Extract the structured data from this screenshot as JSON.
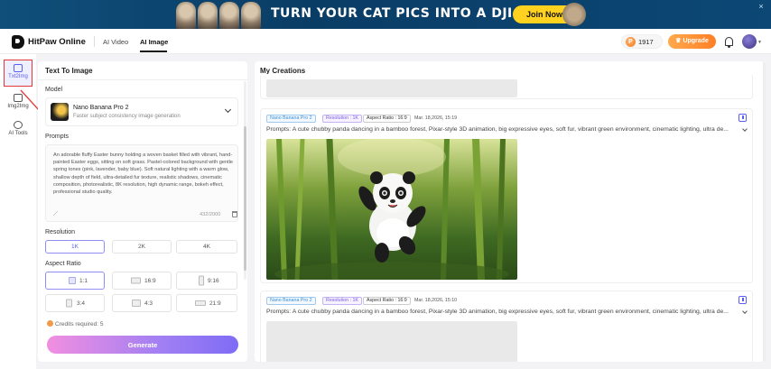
{
  "banner": {
    "headline": "TURN YOUR CAT PICS INTO A DJI",
    "cta": "Join Now",
    "close": "×"
  },
  "header": {
    "logo": "HitPaw Online",
    "nav": [
      {
        "label": "AI Video",
        "active": false
      },
      {
        "label": "AI Image",
        "active": true
      }
    ],
    "credits": "1917",
    "upgrade": "Upgrade"
  },
  "rail": [
    {
      "label": "Txt2Img",
      "active": true,
      "icon": "text-image-icon"
    },
    {
      "label": "Img2Img",
      "active": false,
      "icon": "image-image-icon"
    },
    {
      "label": "AI Tools",
      "active": false,
      "icon": "tools-icon"
    }
  ],
  "panel": {
    "title": "Text To Image",
    "model_label": "Model",
    "model_name": "Nano Banana Pro 2",
    "model_desc": "Faster subject consistency image generation",
    "prompts_label": "Prompts",
    "prompt_text": "An adorable fluffy Easter bunny holding a woven basket filled with vibrant, hand-painted Easter eggs, sitting on soft grass. Pastel-colored background with gentle spring tones (pink, lavender, baby blue). Soft natural lighting with a warm glow, shallow depth of field, ultra-detailed fur texture, realistic shadows, cinematic composition, photorealistic, 8K resolution, high dynamic range, bokeh effect, professional studio quality.",
    "char_count": "432/2000",
    "resolution_label": "Resolution",
    "resolutions": [
      "1K",
      "2K",
      "4K"
    ],
    "resolution_selected": "1K",
    "aspect_label": "Aspect Ratio",
    "aspects": [
      "1:1",
      "16:9",
      "9:16",
      "3:4",
      "4:3",
      "21:9"
    ],
    "aspect_selected": "1:1",
    "credits_required": "Credits required: 5",
    "generate": "Generate"
  },
  "creations": {
    "title": "My Creations",
    "cards": [
      {
        "model_tag": "Nano Banana Pro 2",
        "res_tag": "Resolution : 1K",
        "ar_tag": "Aspect Ratio : 16:9",
        "date": "Mar. 18,2026, 15:19",
        "prompt": "Prompts: A cute chubby panda dancing in a bamboo forest, Pixar-style 3D animation, big expressive eyes, soft fur, vibrant green environment, cinematic lighting, ultra de..."
      },
      {
        "model_tag": "Nano Banana Pro 2",
        "res_tag": "Resolution : 1K",
        "ar_tag": "Aspect Ratio : 16:9",
        "date": "Mar. 18,2026, 15:10",
        "prompt": "Prompts: A cute chubby panda dancing in a bamboo forest, Pixar-style 3D animation, big expressive eyes, soft fur, vibrant green environment, cinematic lighting, ultra de..."
      }
    ]
  },
  "colors": {
    "accent": "#5b5ef0",
    "upgrade": "#ff8c2e",
    "highlight_box": "#e23a3a"
  }
}
